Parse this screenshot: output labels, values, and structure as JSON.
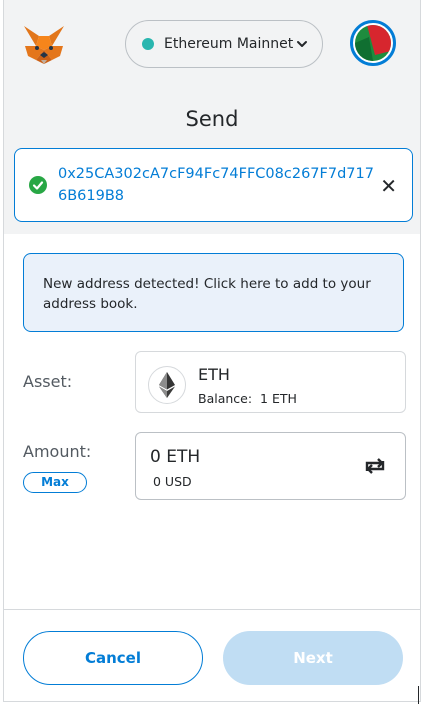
{
  "header": {
    "network_label": "Ethereum Mainnet",
    "network_color": "#29b6af",
    "title": "Send",
    "icons": {
      "logo": "metamask-fox-icon",
      "network_chevron": "chevron-down-icon",
      "account": "account-avatar-icon"
    }
  },
  "recipient": {
    "address": "0x25CA302cA7cF94Fc74FFC08c267F7d7176B619B8",
    "close_glyph": "✕",
    "icon": "check-circle-icon"
  },
  "notice": {
    "text": "New address detected! Click here to add to your address book."
  },
  "asset": {
    "label": "Asset:",
    "symbol": "ETH",
    "balance_label": "Balance:",
    "balance_value": "1 ETH",
    "icon": "ethereum-icon"
  },
  "amount": {
    "label": "Amount:",
    "max_label": "Max",
    "value": "0 ETH",
    "fiat": "0 USD",
    "swap_icon": "swap-currency-icon"
  },
  "footer": {
    "cancel_label": "Cancel",
    "next_label": "Next"
  },
  "colors": {
    "accent": "#037dd6",
    "success": "#28a745",
    "disabled_button": "#c0ddf3"
  }
}
